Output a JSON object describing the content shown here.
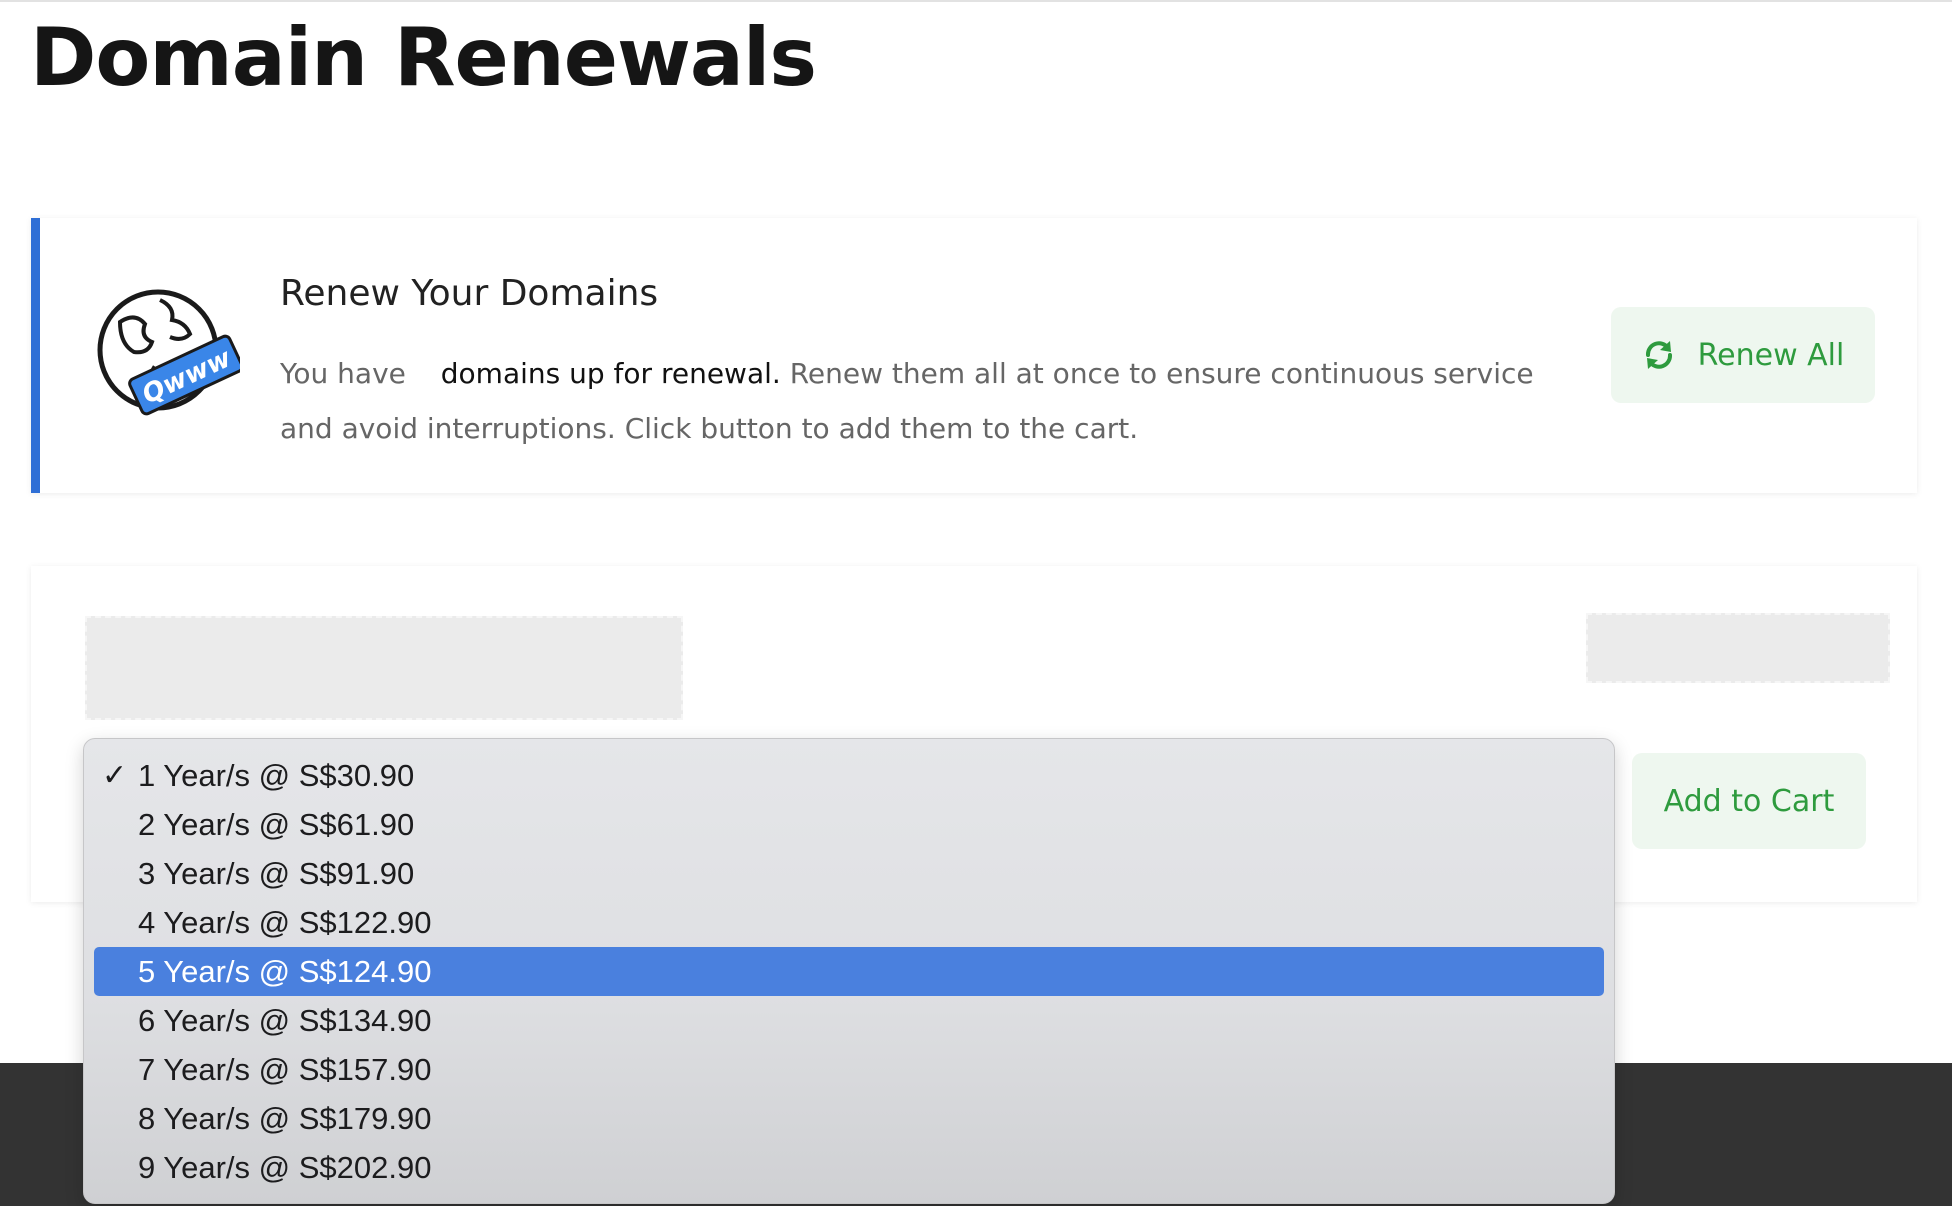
{
  "page": {
    "title": "Domain Renewals"
  },
  "renew_card": {
    "title": "Renew Your Domains",
    "desc_prefix": "You have",
    "desc_emphasis": "domains up for renewal.",
    "desc_rest": "Renew them all at once to ensure continuous service and avoid interruptions. Click button to add them to the cart.",
    "renew_all_label": "Renew All",
    "globe_badge_text": "Qwww"
  },
  "domain_item": {
    "add_to_cart_label": "Add to Cart"
  },
  "year_dropdown": {
    "check_mark": "✓",
    "selected_index": 0,
    "highlighted_index": 4,
    "options": [
      "1 Year/s @ S$30.90",
      "2 Year/s @ S$61.90",
      "3 Year/s @ S$91.90",
      "4 Year/s @ S$122.90",
      "5 Year/s @ S$124.90",
      "6 Year/s @ S$134.90",
      "7 Year/s @ S$157.90",
      "8 Year/s @ S$179.90",
      "9 Year/s @ S$202.90"
    ]
  },
  "colors": {
    "accent_blue": "#2f6fd6",
    "success_green": "#2e9b3e",
    "success_bg": "#eef7ef",
    "highlight_blue": "#4a80de",
    "footer_dark": "#333333"
  }
}
